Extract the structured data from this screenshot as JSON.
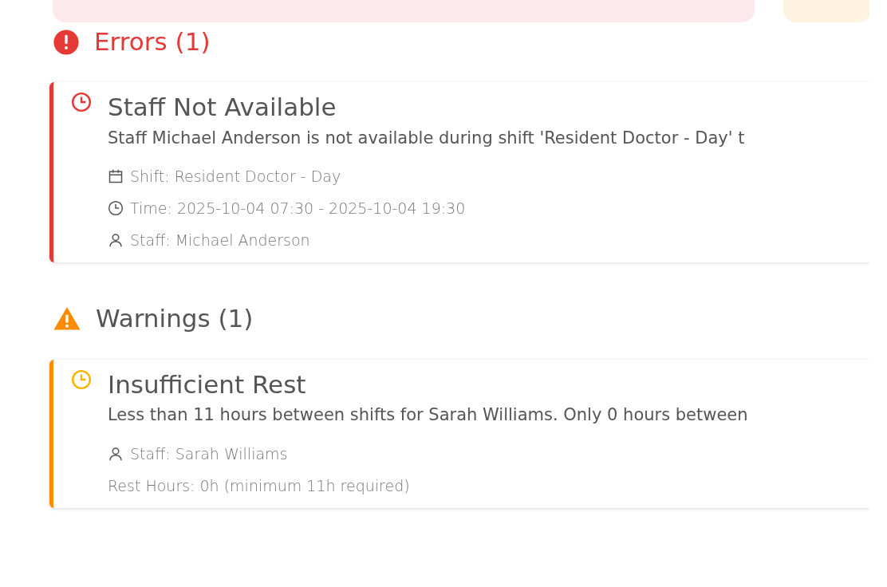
{
  "summary_cards": [
    {
      "kind": "error"
    },
    {
      "kind": "warning"
    }
  ],
  "sections": [
    {
      "kind": "error",
      "title": "Errors (1)",
      "issues": [
        {
          "title": "Staff Not Available",
          "description": "Staff Michael Anderson is not available during shift 'Resident Doctor - Day' t",
          "details": [
            {
              "kind": "shift",
              "text": "Shift: Resident Doctor - Day"
            },
            {
              "kind": "time",
              "text": "Time: 2025-10-04 07:30 - 2025-10-04 19:30"
            },
            {
              "kind": "staff",
              "text": "Staff: Michael Anderson"
            }
          ]
        }
      ]
    },
    {
      "kind": "warning",
      "title": "Warnings (1)",
      "issues": [
        {
          "title": "Insufficient Rest",
          "description": "Less than 11 hours between shifts for Sarah Williams. Only 0 hours between",
          "details": [
            {
              "kind": "staff",
              "text": "Staff: Sarah Williams"
            },
            {
              "kind": "plain",
              "text": "Rest Hours: 0h (minimum 11h required)"
            }
          ]
        }
      ]
    }
  ]
}
